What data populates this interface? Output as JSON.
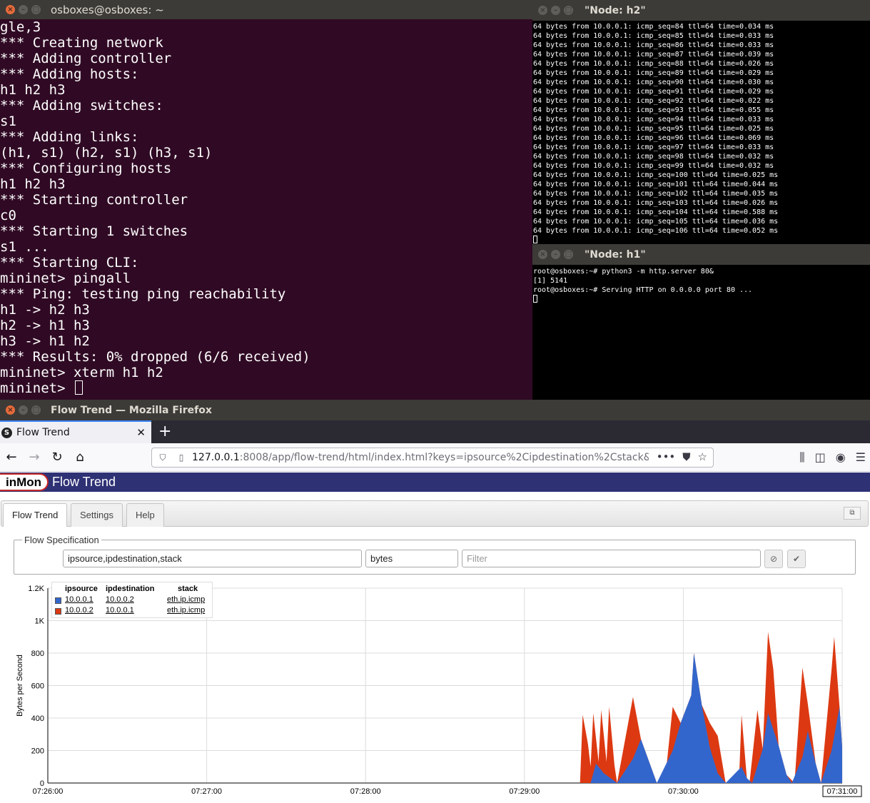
{
  "terminal": {
    "title": "osboxes@osboxes: ~",
    "lines": [
      "gle,3",
      "*** Creating network",
      "*** Adding controller",
      "*** Adding hosts:",
      "h1 h2 h3",
      "*** Adding switches:",
      "s1",
      "*** Adding links:",
      "(h1, s1) (h2, s1) (h3, s1)",
      "*** Configuring hosts",
      "h1 h2 h3",
      "*** Starting controller",
      "c0",
      "*** Starting 1 switches",
      "s1 ...",
      "*** Starting CLI:",
      "mininet> pingall",
      "*** Ping: testing ping reachability",
      "h1 -> h2 h3",
      "h2 -> h1 h3",
      "h3 -> h1 h2",
      "*** Results: 0% dropped (6/6 received)",
      "mininet> xterm h1 h2"
    ],
    "prompt": "mininet> "
  },
  "node_h2": {
    "title": "\"Node: h2\"",
    "lines": [
      "64 bytes from 10.0.0.1: icmp_seq=84 ttl=64 time=0.034 ms",
      "64 bytes from 10.0.0.1: icmp_seq=85 ttl=64 time=0.033 ms",
      "64 bytes from 10.0.0.1: icmp_seq=86 ttl=64 time=0.033 ms",
      "64 bytes from 10.0.0.1: icmp_seq=87 ttl=64 time=0.039 ms",
      "64 bytes from 10.0.0.1: icmp_seq=88 ttl=64 time=0.026 ms",
      "64 bytes from 10.0.0.1: icmp_seq=89 ttl=64 time=0.029 ms",
      "64 bytes from 10.0.0.1: icmp_seq=90 ttl=64 time=0.030 ms",
      "64 bytes from 10.0.0.1: icmp_seq=91 ttl=64 time=0.029 ms",
      "64 bytes from 10.0.0.1: icmp_seq=92 ttl=64 time=0.022 ms",
      "64 bytes from 10.0.0.1: icmp_seq=93 ttl=64 time=0.055 ms",
      "64 bytes from 10.0.0.1: icmp_seq=94 ttl=64 time=0.033 ms",
      "64 bytes from 10.0.0.1: icmp_seq=95 ttl=64 time=0.025 ms",
      "64 bytes from 10.0.0.1: icmp_seq=96 ttl=64 time=0.069 ms",
      "64 bytes from 10.0.0.1: icmp_seq=97 ttl=64 time=0.033 ms",
      "64 bytes from 10.0.0.1: icmp_seq=98 ttl=64 time=0.032 ms",
      "64 bytes from 10.0.0.1: icmp_seq=99 ttl=64 time=0.032 ms",
      "64 bytes from 10.0.0.1: icmp_seq=100 ttl=64 time=0.025 ms",
      "64 bytes from 10.0.0.1: icmp_seq=101 ttl=64 time=0.044 ms",
      "64 bytes from 10.0.0.1: icmp_seq=102 ttl=64 time=0.035 ms",
      "64 bytes from 10.0.0.1: icmp_seq=103 ttl=64 time=0.026 ms",
      "64 bytes from 10.0.0.1: icmp_seq=104 ttl=64 time=0.588 ms",
      "64 bytes from 10.0.0.1: icmp_seq=105 ttl=64 time=0.036 ms",
      "64 bytes from 10.0.0.1: icmp_seq=106 ttl=64 time=0.052 ms"
    ]
  },
  "node_h1": {
    "title": "\"Node: h1\"",
    "lines": [
      "root@osboxes:~# python3 -m http.server 80&",
      "[1] 5141",
      "root@osboxes:~# Serving HTTP on 0.0.0.0 port 80 ..."
    ]
  },
  "firefox": {
    "window_title": "Flow Trend — Mozilla Firefox",
    "tab_label": "Flow Trend",
    "tab_favicon": "S",
    "url_host": "127.0.0.1",
    "url_rest": ":8008/app/flow-trend/html/index.html?keys=ipsource%2Cipdestination%2Cstack&val",
    "url_more": "•••"
  },
  "app": {
    "logo": "inMon",
    "title": "Flow Trend",
    "tabs": [
      "Flow Trend",
      "Settings",
      "Help"
    ],
    "flow_spec_legend": "Flow Specification",
    "keys_value": "ipsource,ipdestination,stack",
    "value_field": "bytes",
    "filter_placeholder": "Filter"
  },
  "colors": {
    "series_blue": "#3366cc",
    "series_red": "#dc3912",
    "terminal_bg": "#300a24"
  },
  "chart_data": {
    "type": "area",
    "ylabel": "Bytes per Second",
    "ylim": [
      0,
      1200
    ],
    "yticks": [
      "0",
      "200",
      "400",
      "600",
      "800",
      "1K",
      "1.2K"
    ],
    "xticks": [
      "07:26:00",
      "07:27:00",
      "07:28:00",
      "07:29:00",
      "07:30:00",
      "07:31:00"
    ],
    "legend_headers": [
      "ipsource",
      "ipdestination",
      "stack"
    ],
    "stacked": true,
    "grid": true,
    "legend_position": "top-left",
    "series": [
      {
        "ipsource": "10.0.0.1",
        "ipdestination": "10.0.0.2",
        "stack": "eth.ip.icmp",
        "color": "#3366cc",
        "points": [
          [
            0,
            0
          ],
          [
            200,
            0
          ],
          [
            205,
            0
          ],
          [
            207,
            120
          ],
          [
            210,
            60
          ],
          [
            215,
            0
          ],
          [
            221,
            150
          ],
          [
            224,
            270
          ],
          [
            228,
            90
          ],
          [
            230,
            0
          ],
          [
            236,
            200
          ],
          [
            239,
            370
          ],
          [
            243,
            540
          ],
          [
            244,
            800
          ],
          [
            247,
            480
          ],
          [
            250,
            220
          ],
          [
            253,
            60
          ],
          [
            256,
            0
          ],
          [
            262,
            100
          ],
          [
            264,
            30
          ],
          [
            266,
            0
          ],
          [
            270,
            210
          ],
          [
            272,
            430
          ],
          [
            276,
            230
          ],
          [
            279,
            50
          ],
          [
            281,
            0
          ],
          [
            285,
            160
          ],
          [
            287,
            320
          ],
          [
            290,
            120
          ],
          [
            292,
            0
          ],
          [
            296,
            200
          ],
          [
            299,
            470
          ],
          [
            302,
            220
          ],
          [
            304,
            60
          ],
          [
            306,
            0
          ],
          [
            310,
            90
          ],
          [
            312,
            150
          ],
          [
            315,
            60
          ],
          [
            318,
            0
          ],
          [
            323,
            150
          ],
          [
            324,
            510
          ],
          [
            326,
            470
          ],
          [
            327,
            380
          ],
          [
            328,
            360
          ],
          [
            330,
            0
          ]
        ]
      },
      {
        "ipsource": "10.0.0.2",
        "ipdestination": "10.0.0.1",
        "stack": "eth.ip.icmp",
        "color": "#dc3912",
        "points": [
          [
            0,
            0
          ],
          [
            200,
            0
          ],
          [
            201,
            0
          ],
          [
            202,
            420
          ],
          [
            204,
            240
          ],
          [
            205,
            100
          ],
          [
            206,
            430
          ],
          [
            208,
            130
          ],
          [
            209,
            450
          ],
          [
            211,
            130
          ],
          [
            212,
            470
          ],
          [
            214,
            110
          ],
          [
            215,
            0
          ],
          [
            221,
            530
          ],
          [
            224,
            270
          ],
          [
            228,
            90
          ],
          [
            230,
            0
          ],
          [
            233,
            0
          ],
          [
            236,
            470
          ],
          [
            239,
            370
          ],
          [
            243,
            540
          ],
          [
            244,
            800
          ],
          [
            247,
            480
          ],
          [
            250,
            370
          ],
          [
            253,
            290
          ],
          [
            256,
            0
          ],
          [
            261,
            0
          ],
          [
            262,
            420
          ],
          [
            264,
            30
          ],
          [
            265,
            0
          ],
          [
            268,
            450
          ],
          [
            270,
            210
          ],
          [
            272,
            930
          ],
          [
            274,
            700
          ],
          [
            276,
            230
          ],
          [
            279,
            50
          ],
          [
            282,
            0
          ],
          [
            285,
            710
          ],
          [
            287,
            490
          ],
          [
            290,
            120
          ],
          [
            292,
            0
          ],
          [
            296,
            700
          ],
          [
            297,
            900
          ],
          [
            299,
            470
          ],
          [
            302,
            220
          ],
          [
            304,
            60
          ],
          [
            306,
            0
          ],
          [
            308,
            360
          ],
          [
            310,
            230
          ],
          [
            312,
            370
          ],
          [
            314,
            130
          ],
          [
            316,
            0
          ],
          [
            320,
            0
          ],
          [
            323,
            150
          ],
          [
            324,
            510
          ],
          [
            326,
            470
          ],
          [
            327,
            590
          ],
          [
            328,
            760
          ],
          [
            330,
            990
          ]
        ]
      }
    ]
  }
}
